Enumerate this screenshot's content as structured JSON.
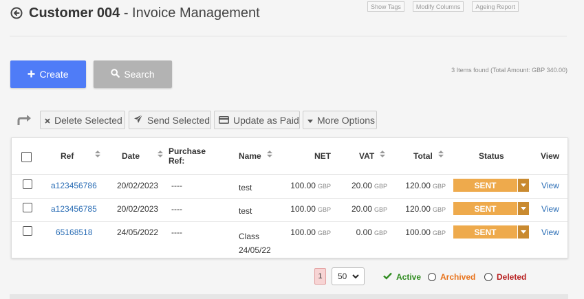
{
  "header": {
    "title_bold": "Customer 004",
    "title_rest": " - Invoice Management"
  },
  "top_links": [
    "Show Tags",
    "Modify Columns",
    "Ageing Report"
  ],
  "buttons": {
    "create": "Create",
    "search": "Search"
  },
  "items_found": "3 Items found (Total Amount: GBP 340.00)",
  "bulk_actions": {
    "delete": "Delete Selected",
    "send": "Send Selected",
    "paid": "Update as Paid",
    "more": "More Options"
  },
  "table": {
    "headers": {
      "ref": "Ref",
      "date": "Date",
      "purchase_ref_1": "Purchase",
      "purchase_ref_2": "Ref:",
      "name": "Name",
      "net": "NET",
      "vat": "VAT",
      "total": "Total",
      "status": "Status",
      "view": "View"
    },
    "currency": "GBP",
    "rows": [
      {
        "ref": "a123456786",
        "date": "20/02/2023",
        "purchase_ref": "----",
        "name": "test",
        "name2": "",
        "net": "100.00",
        "vat": "20.00",
        "total": "120.00",
        "status": "SENT",
        "view": "View"
      },
      {
        "ref": "a123456785",
        "date": "20/02/2023",
        "purchase_ref": "----",
        "name": "test",
        "name2": "",
        "net": "100.00",
        "vat": "20.00",
        "total": "120.00",
        "status": "SENT",
        "view": "View"
      },
      {
        "ref": "65168518",
        "date": "24/05/2022",
        "purchase_ref": "----",
        "name": "Class",
        "name2": "24/05/22",
        "net": "100.00",
        "vat": "0.00",
        "total": "100.00",
        "status": "SENT",
        "view": "View"
      }
    ]
  },
  "pagination": {
    "current_page": "1",
    "per_page": "50"
  },
  "filters": {
    "active": "Active",
    "archived": "Archived",
    "deleted": "Deleted"
  },
  "colors": {
    "primary": "#4f7cf7",
    "status_sent": "#eeaa4c",
    "link": "#2a6db5",
    "active": "#2e8b1e",
    "archived": "#e8731c",
    "deleted": "#b82020"
  }
}
